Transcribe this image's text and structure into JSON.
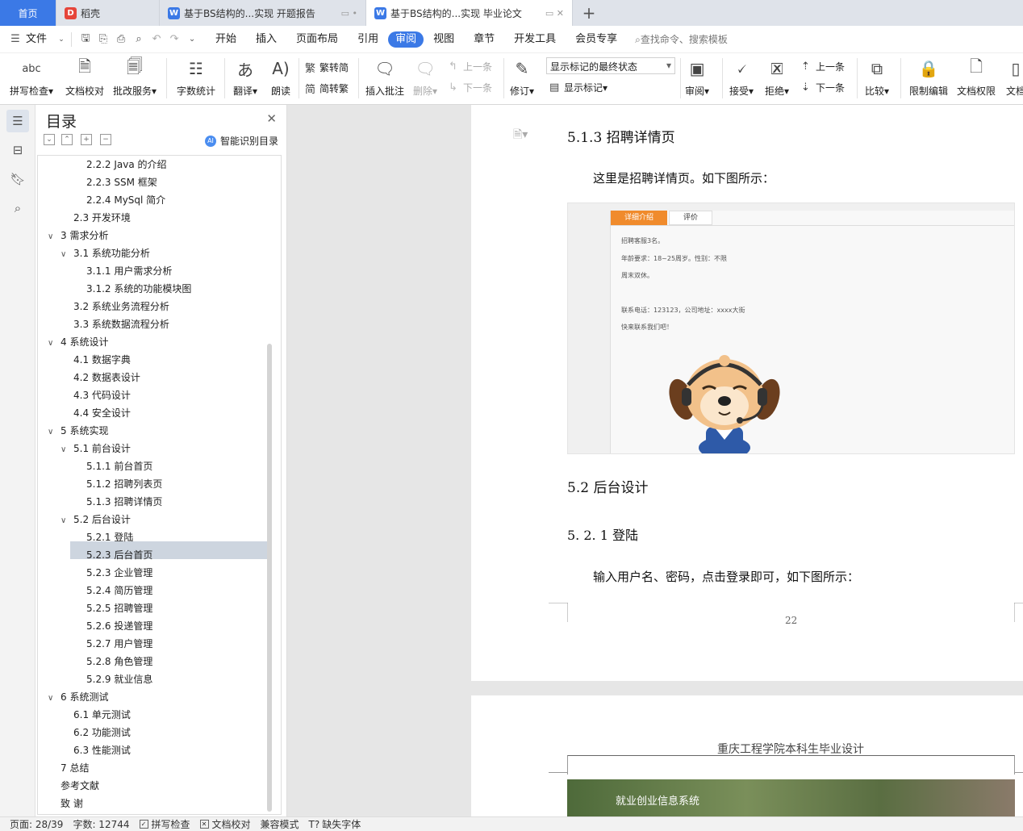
{
  "tabs": [
    {
      "label": "首页"
    },
    {
      "label": "稻壳"
    },
    {
      "label": "基于BS结构的...实现 开题报告"
    },
    {
      "label": "基于BS结构的...实现 毕业论文"
    }
  ],
  "menu": {
    "file": "文件",
    "items": [
      "开始",
      "插入",
      "页面布局",
      "引用",
      "审阅",
      "视图",
      "章节",
      "开发工具",
      "会员专享"
    ],
    "active_item": "审阅",
    "search": "查找命令、搜索模板"
  },
  "ribbon": {
    "spell_check": "拼写检查",
    "doc_proofread": "文档校对",
    "batch_service": "批改服务",
    "word_count": "字数统计",
    "translate": "翻译",
    "read_aloud": "朗读",
    "to_traditional": "繁转简",
    "to_simplified": "简转繁",
    "insert_comment": "插入批注",
    "delete": "删除",
    "prev_comment": "上一条",
    "next_comment": "下一条",
    "track_changes": "修订",
    "markup_select": "显示标记的最终状态",
    "show_markup": "显示标记",
    "review": "审阅",
    "accept": "接受",
    "reject": "拒绝",
    "prev_change": "上一条",
    "next_change": "下一条",
    "compare": "比较",
    "restrict_edit": "限制编辑",
    "doc_permission": "文档权限",
    "doc_cut": "文档"
  },
  "toc": {
    "title": "目录",
    "smart_toc": "智能识别目录",
    "items": [
      {
        "label": "2.2.2 Java 的介绍"
      },
      {
        "label": "2.2.3 SSM 框架"
      },
      {
        "label": "2.2.4 MySql 简介"
      },
      {
        "label": "2.3  开发环境"
      },
      {
        "label": "3  需求分析"
      },
      {
        "label": "3.1  系统功能分析"
      },
      {
        "label": "3.1.1  用户需求分析"
      },
      {
        "label": "3.1.2  系统的功能模块图"
      },
      {
        "label": "3.2  系统业务流程分析"
      },
      {
        "label": "3.3  系统数据流程分析"
      },
      {
        "label": "4  系统设计"
      },
      {
        "label": "4.1  数据字典"
      },
      {
        "label": "4.2  数据表设计"
      },
      {
        "label": "4.3  代码设计"
      },
      {
        "label": "4.4  安全设计"
      },
      {
        "label": "5  系统实现"
      },
      {
        "label": "5.1  前台设计"
      },
      {
        "label": "5.1.1  前台首页"
      },
      {
        "label": "5.1.2  招聘列表页"
      },
      {
        "label": "5.1.3  招聘详情页"
      },
      {
        "label": "5.2  后台设计"
      },
      {
        "label": "5.2.1  登陆"
      },
      {
        "label": "5.2.3  后台首页"
      },
      {
        "label": "5.2.3  企业管理"
      },
      {
        "label": "5.2.4  简历管理"
      },
      {
        "label": "5.2.5  招聘管理"
      },
      {
        "label": "5.2.6  投递管理"
      },
      {
        "label": "5.2.7  用户管理"
      },
      {
        "label": "5.2.8  角色管理"
      },
      {
        "label": "5.2.9  就业信息"
      },
      {
        "label": "6  系统测试"
      },
      {
        "label": "6.1  单元测试"
      },
      {
        "label": "6.2  功能测试"
      },
      {
        "label": "6.3  性能测试"
      },
      {
        "label": "7  总结"
      },
      {
        "label": "参考文献"
      },
      {
        "label": "致   谢"
      }
    ]
  },
  "document": {
    "h_513": "5.1.3  招聘详情页",
    "p_513": "这里是招聘详情页。如下图所示：",
    "figure1": {
      "tab_detail": "详细介绍",
      "tab_review": "评价",
      "lines": [
        "招聘客服3名。",
        "年龄要求：18~25周岁。性别：不限",
        "周末双休。",
        "联系电话：123123，公司地址：xxxx大街",
        "快来联系我们吧！"
      ]
    },
    "h_52": "5.2  后台设计",
    "h_521": "5. 2. 1  登陆",
    "p_521": "输入用户名、密码，点击登录即可，如下图所示：",
    "page_number": "22",
    "page2_header": "重庆工程学院本科生毕业设计",
    "figure2_text": "就业创业信息系统"
  },
  "status": {
    "page": "页面: 28/39",
    "words": "字数: 12744",
    "spell": "拼写检查",
    "proof": "文档校对",
    "compat": "兼容模式",
    "missing_font": "缺失字体"
  }
}
